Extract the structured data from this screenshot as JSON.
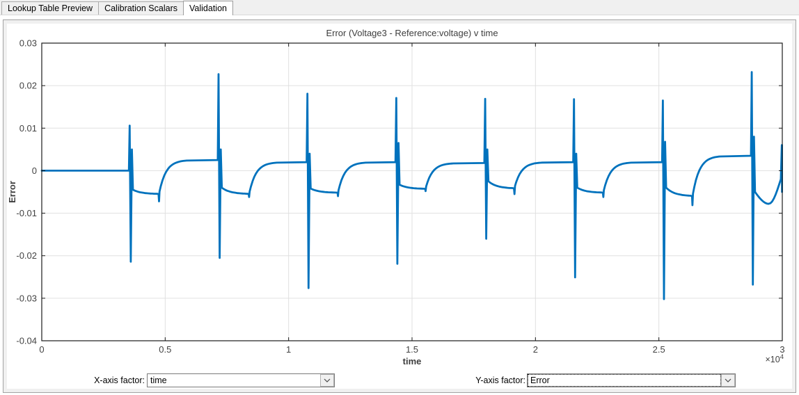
{
  "tabs": [
    {
      "label": "Lookup Table Preview",
      "active": false
    },
    {
      "label": "Calibration Scalars",
      "active": false
    },
    {
      "label": "Validation",
      "active": true
    }
  ],
  "controls": {
    "x_factor": {
      "label": "X-axis factor:",
      "value": "time"
    },
    "y_factor": {
      "label": "Y-axis factor:",
      "value": "Error",
      "focused": true
    }
  },
  "chart_data": {
    "type": "line",
    "title": "Error (Voltage3 - Reference:voltage) v time",
    "xlabel": "time",
    "ylabel": "Error",
    "xlim": [
      0,
      30000
    ],
    "ylim": [
      -0.04,
      0.03
    ],
    "x_multiplier": {
      "base": "×10",
      "exponent": "4"
    },
    "xticks": [
      {
        "v": 0,
        "label": "0"
      },
      {
        "v": 5000,
        "label": "0.5"
      },
      {
        "v": 10000,
        "label": "1"
      },
      {
        "v": 15000,
        "label": "1.5"
      },
      {
        "v": 20000,
        "label": "2"
      },
      {
        "v": 25000,
        "label": "2.5"
      },
      {
        "v": 30000,
        "label": "3"
      }
    ],
    "yticks": [
      {
        "v": 0.03,
        "label": "0.03"
      },
      {
        "v": 0.02,
        "label": "0.02"
      },
      {
        "v": 0.01,
        "label": "0.01"
      },
      {
        "v": 0,
        "label": "0"
      },
      {
        "v": -0.01,
        "label": "-0.01"
      },
      {
        "v": -0.02,
        "label": "-0.02"
      },
      {
        "v": -0.03,
        "label": "-0.03"
      },
      {
        "v": -0.04,
        "label": "-0.04"
      }
    ],
    "grid": true,
    "legend": "none",
    "line_width": 2.8,
    "colors": {
      "line": "#0072BD",
      "grid": "#e0e0e0",
      "axis": "#1a1a1a"
    },
    "series": {
      "name": "Error",
      "baseline": {
        "from": 0,
        "to": 3600,
        "value": 0
      },
      "periods": [
        {
          "t": 3600,
          "up": 0.0106,
          "down": -0.0214,
          "ledge": 0.005,
          "exit": -0.0045,
          "dip_end": -0.0055,
          "notch_t": 4750,
          "notch_v": -0.0072,
          "plateau": 0.0025
        },
        {
          "t": 7200,
          "up": 0.0227,
          "down": -0.0205,
          "ledge": 0.005,
          "exit": -0.004,
          "dip_end": -0.0055,
          "notch_t": 8400,
          "notch_v": -0.0062,
          "plateau": 0.002
        },
        {
          "t": 10800,
          "up": 0.0181,
          "down": -0.0276,
          "ledge": 0.004,
          "exit": -0.0042,
          "dip_end": -0.0052,
          "notch_t": 12000,
          "notch_v": -0.006,
          "plateau": 0.002
        },
        {
          "t": 14400,
          "up": 0.0171,
          "down": -0.0219,
          "ledge": 0.0065,
          "exit": -0.0033,
          "dip_end": -0.0043,
          "notch_t": 15550,
          "notch_v": -0.0048,
          "plateau": 0.0018
        },
        {
          "t": 18000,
          "up": 0.0169,
          "down": -0.016,
          "ledge": 0.005,
          "exit": -0.0025,
          "dip_end": -0.0042,
          "notch_t": 19150,
          "notch_v": -0.0055,
          "plateau": 0.002
        },
        {
          "t": 21600,
          "up": 0.0168,
          "down": -0.0251,
          "ledge": 0.004,
          "exit": -0.004,
          "dip_end": -0.0052,
          "notch_t": 22750,
          "notch_v": -0.0062,
          "plateau": 0.002
        },
        {
          "t": 25200,
          "up": 0.0165,
          "down": -0.0302,
          "ledge": 0.0068,
          "exit": -0.004,
          "dip_end": -0.006,
          "notch_t": 26360,
          "notch_v": -0.0081,
          "plateau": 0.0035
        },
        {
          "t": 28800,
          "up": 0.0232,
          "down": -0.0268,
          "ledge": 0.008,
          "exit": -0.005
        }
      ],
      "tail": {
        "dip_min_t": 29450,
        "dip_min": -0.0078,
        "end_t": 29940,
        "end_v": -0.002,
        "final_t": 29990,
        "final_top": 0.006,
        "final_bottom": -0.005
      }
    }
  }
}
